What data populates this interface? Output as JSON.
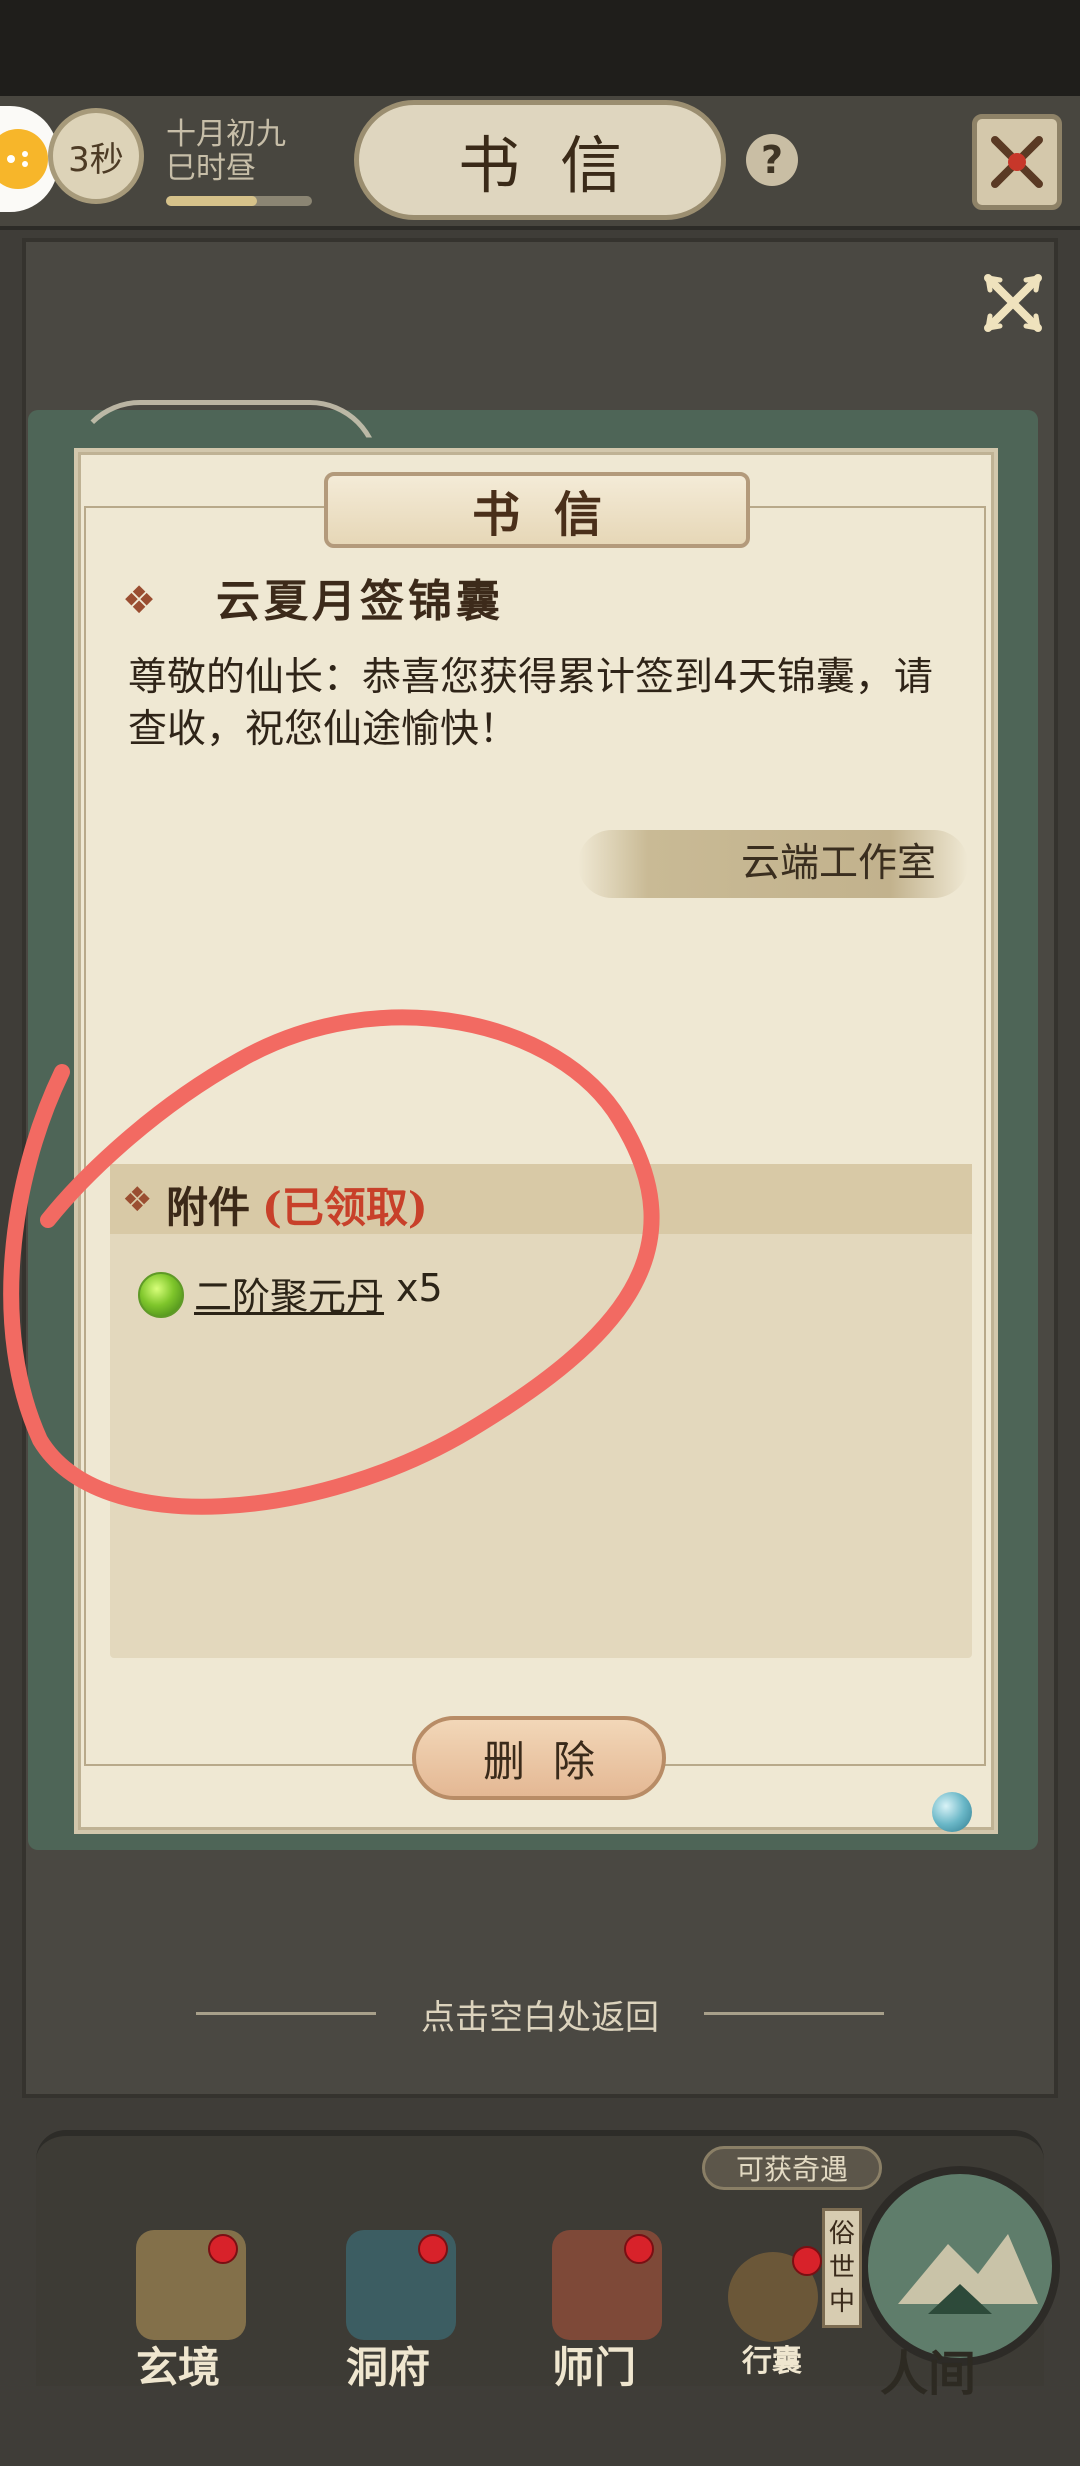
{
  "header": {
    "timer": "3秒",
    "date_line1": "十月初九",
    "date_line2": "巳时昼",
    "title": "书信",
    "progress": 0.62
  },
  "letter": {
    "plaque_title": "书信",
    "subject": "云夏月签锦囊",
    "body": "尊敬的仙长：恭喜您获得累计签到4天锦囊，请查收，祝您仙途愉快！",
    "sender": "云端工作室",
    "attachment_label": "附件",
    "attachment_status": "(已领取)",
    "item_name": "二阶聚元丹",
    "item_qty": "x5",
    "delete_button": "删除"
  },
  "return_hint": "点击空白处返回",
  "bottom_nav": {
    "bubble": "可获奇遇",
    "tag": "俗世中",
    "items": [
      {
        "label": "玄境"
      },
      {
        "label": "洞府"
      },
      {
        "label": "师门"
      },
      {
        "label": "行囊"
      },
      {
        "label": "人间"
      }
    ]
  },
  "colors": {
    "accent_red": "#c8402a",
    "annotation": "#f26a62",
    "paper": "#efe8d3"
  }
}
